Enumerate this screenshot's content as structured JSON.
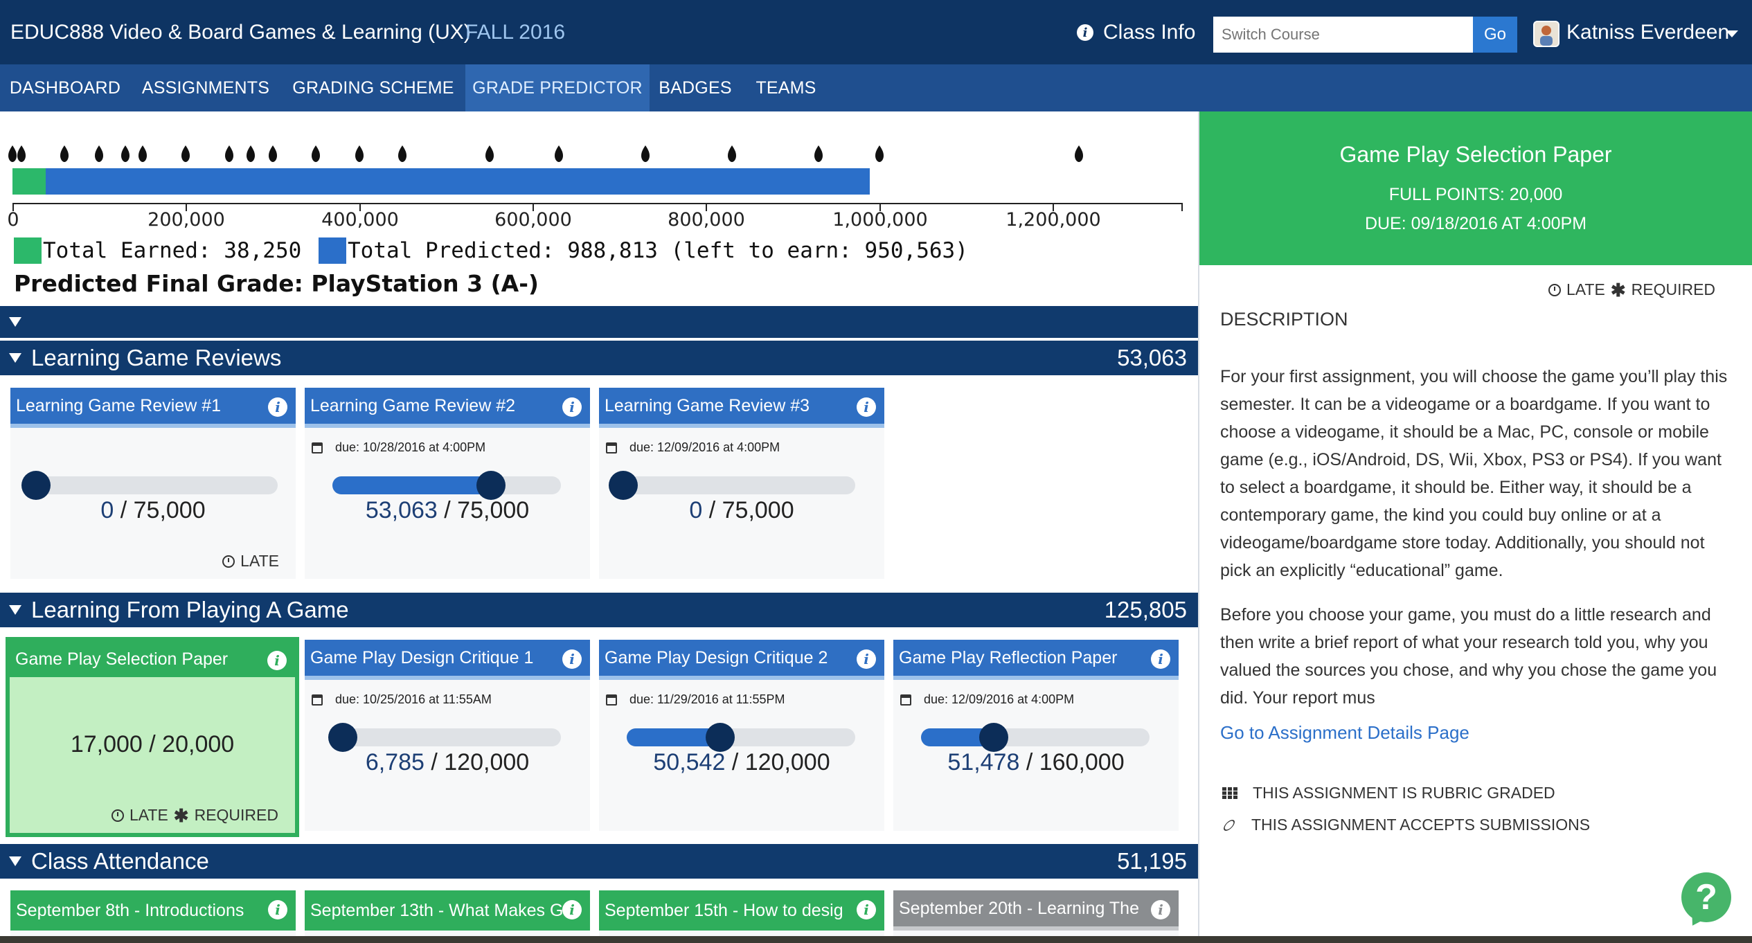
{
  "header": {
    "course_code": "EDUC888  Video & Board Games & Learning (UX)",
    "term": "FALL 2016",
    "class_info": "Class Info",
    "switch_course_placeholder": "Switch Course",
    "go_label": "Go",
    "user_name": "Katniss Everdeen"
  },
  "nav": {
    "tabs": [
      {
        "label": "DASHBOARD"
      },
      {
        "label": "ASSIGNMENTS"
      },
      {
        "label": "GRADING SCHEME"
      },
      {
        "label": "GRADE PREDICTOR",
        "active": true
      },
      {
        "label": "BADGES"
      },
      {
        "label": "TEAMS"
      }
    ]
  },
  "predictor": {
    "axis_ticks": [
      "0",
      "200,000",
      "400,000",
      "600,000",
      "800,000",
      "1,000,000",
      "1,200,000"
    ],
    "axis_max": 1350000,
    "earned": 38250,
    "predicted": 988813,
    "grade_thresholds": [
      0,
      10000,
      60000,
      100000,
      130000,
      150000,
      200000,
      250000,
      275000,
      300000,
      350000,
      400000,
      450000,
      550000,
      630000,
      730000,
      830000,
      930000,
      1000000,
      1230000
    ],
    "legend_earned": "Total Earned: 38,250",
    "legend_predicted": "Total Predicted: 988,813 (left to earn: 950,563)",
    "final_grade": "Predicted Final Grade: PlayStation 3 (A-)",
    "colors": {
      "earned": "#2cb86a",
      "predicted": "#2b6fc9"
    }
  },
  "sections": [
    {
      "title": "Learning Game Reviews",
      "total": "53,063",
      "cards": [
        {
          "title": "Learning Game Review #1",
          "due": "",
          "earned": "0",
          "possible": "/ 75,000",
          "fraction": 0.0,
          "flags": [
            "LATE"
          ]
        },
        {
          "title": "Learning Game Review #2",
          "due": "due: 10/28/2016 at 4:00PM",
          "earned": "53,063",
          "possible": "/ 75,000",
          "fraction": 0.7075,
          "flags": []
        },
        {
          "title": "Learning Game Review #3",
          "due": "due: 12/09/2016 at 4:00PM",
          "earned": "0",
          "possible": "/ 75,000",
          "fraction": 0.0,
          "flags": []
        }
      ]
    },
    {
      "title": "Learning From Playing A Game",
      "total": "125,805",
      "cards": [
        {
          "title": "Game Play Selection Paper",
          "due": "",
          "earned": "17,000",
          "possible": "/ 20,000",
          "selected": true,
          "flags": [
            "LATE",
            "REQUIRED"
          ]
        },
        {
          "title": "Game Play Design Critique 1",
          "due": "due: 10/25/2016 at 11:55AM",
          "earned": "6,785",
          "possible": "/ 120,000",
          "fraction": 0.0565,
          "flags": []
        },
        {
          "title": "Game Play Design Critique 2",
          "due": "due: 11/29/2016 at 11:55PM",
          "earned": "50,542",
          "possible": "/ 120,000",
          "fraction": 0.4212,
          "flags": []
        },
        {
          "title": "Game Play Reflection Paper",
          "due": "due: 12/09/2016 at 4:00PM",
          "earned": "51,478",
          "possible": "/ 160,000",
          "fraction": 0.3217,
          "flags": []
        }
      ]
    },
    {
      "title": "Class Attendance",
      "total": "51,195",
      "cards": [
        {
          "title": "September 8th - Introductions"
        },
        {
          "title": "September 13th - What Makes G"
        },
        {
          "title": "September 15th - How to desig"
        },
        {
          "title": "September 20th - Learning The",
          "grey": true
        }
      ]
    }
  ],
  "detail": {
    "title": "Game Play Selection Paper",
    "points": "FULL POINTS: 20,000",
    "due": "DUE: 09/18/2016 AT 4:00PM",
    "flag_late": "LATE",
    "flag_required": "REQUIRED",
    "description_heading": "DESCRIPTION",
    "paragraph_1": "For your first assignment, you will choose the game you’ll play this semester. It can be a videogame or a boardgame. If you want to choose a videogame, it should be a Mac, PC, console or mobile game (e.g., iOS/Android, DS, Wii, Xbox, PS3 or PS4). If you want to select a boardgame, it should be. Either way, it should be a contemporary game, the kind you could buy online or at a videogame/boardgame store today. Additionally, you should not pick an explicitly “educational” game.",
    "paragraph_2": "Before you choose your game, you must do a little research and then write a brief report of what your research told you, why you valued the sources you chose, and why you chose the game you did. Your report mus",
    "link": "Go to Assignment Details Page",
    "rubric": "THIS ASSIGNMENT IS RUBRIC GRADED",
    "submissions": "THIS ASSIGNMENT ACCEPTS SUBMISSIONS",
    "help": "?"
  }
}
